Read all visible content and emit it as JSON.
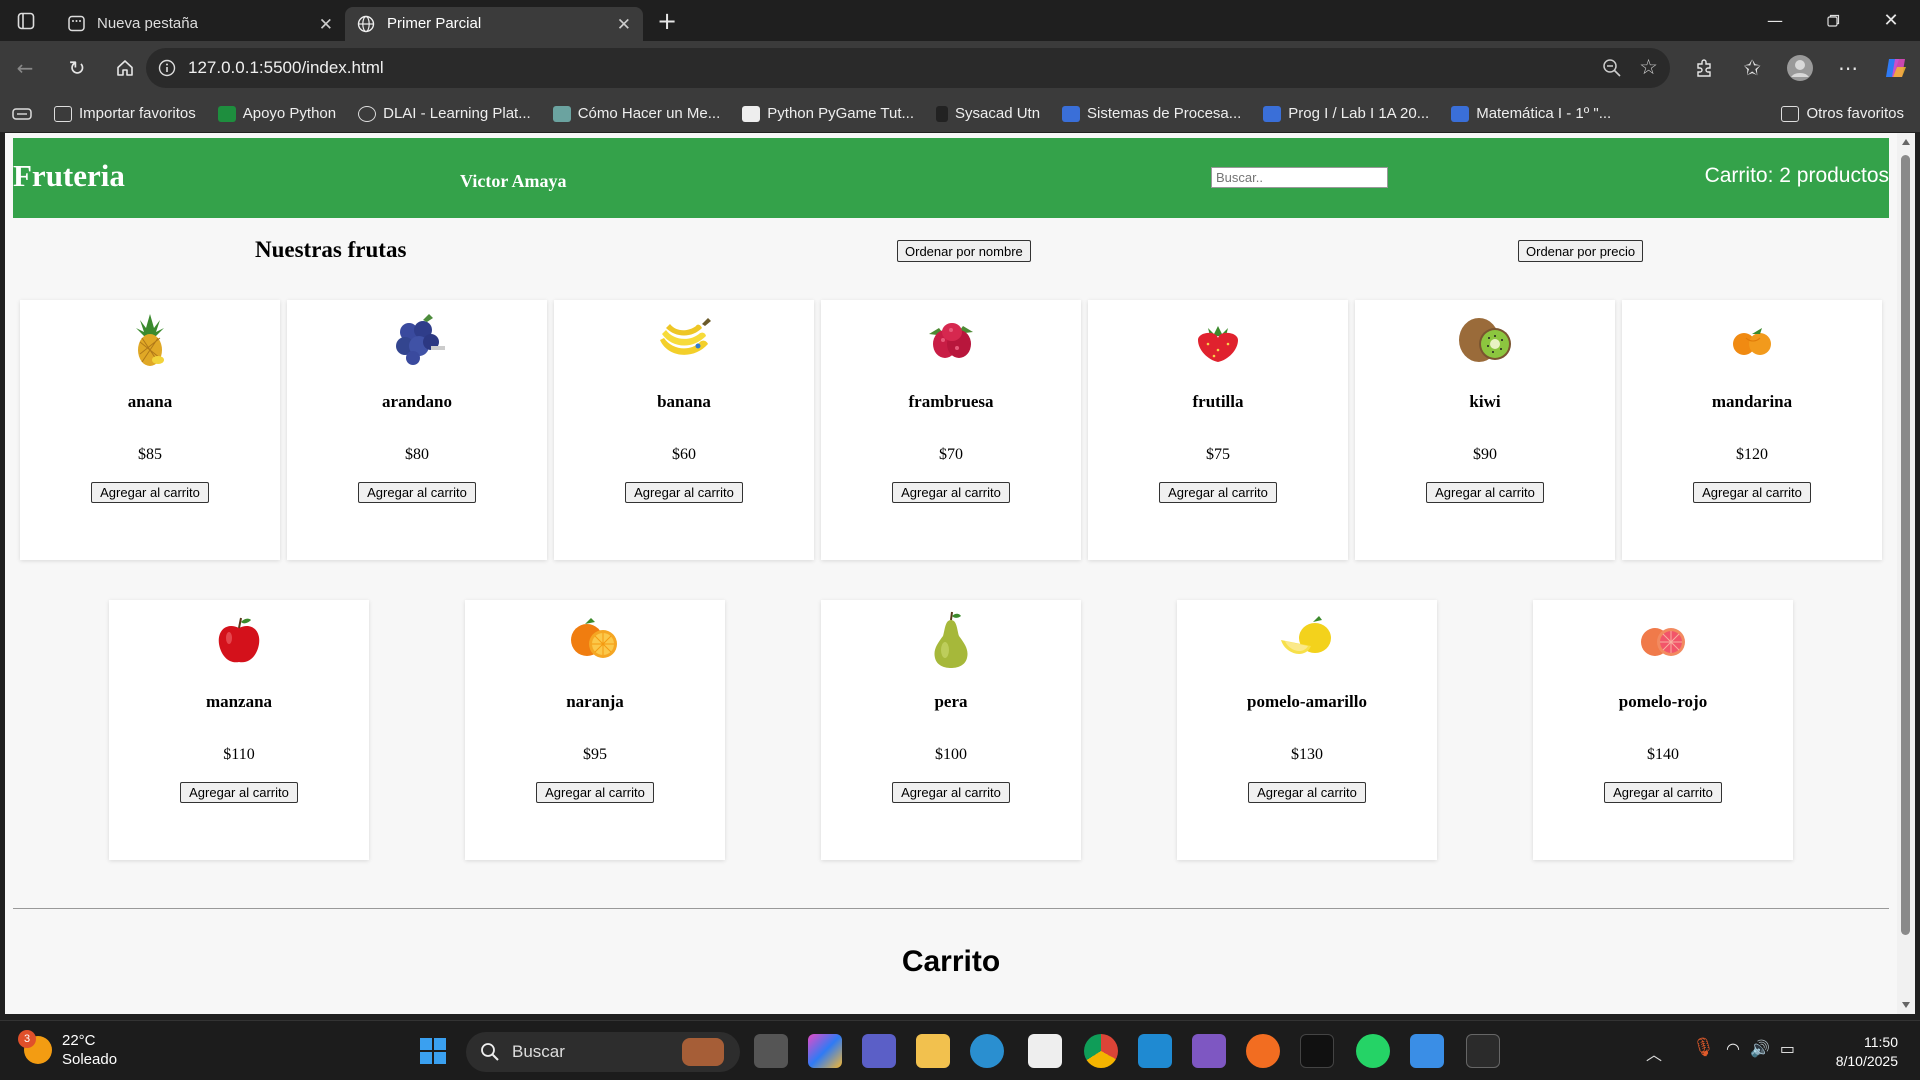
{
  "browser": {
    "tabs": [
      {
        "title": "Nueva pestaña",
        "active": false
      },
      {
        "title": "Primer Parcial",
        "active": true
      }
    ],
    "url": "127.0.0.1:5500/index.html",
    "bookmarks": [
      "Importar favoritos",
      "Apoyo Python",
      "DLAI - Learning Plat...",
      "Cómo Hacer un Me...",
      "Python PyGame Tut...",
      "Sysacad Utn",
      "Sistemas de Procesa...",
      "Prog I / Lab I 1A 20...",
      "Matemática I - 1º \"..."
    ],
    "other_bookmarks": "Otros favoritos"
  },
  "site": {
    "brand": "Fruteria",
    "author": "Victor Amaya",
    "search_placeholder": "Buscar..",
    "cart_count": "Carrito: 2 productos",
    "section_title": "Nuestras frutas",
    "sort_by_name": "Ordenar por nombre",
    "sort_by_price": "Ordenar por precio",
    "add_label": "Agregar al carrito",
    "cart_title": "Carrito",
    "accent_color": "#34a24a",
    "products": [
      {
        "name": "anana",
        "price": "$85",
        "icon": "pineapple-icon"
      },
      {
        "name": "arandano",
        "price": "$80",
        "icon": "blueberry-icon"
      },
      {
        "name": "banana",
        "price": "$60",
        "icon": "banana-icon"
      },
      {
        "name": "frambruesa",
        "price": "$70",
        "icon": "raspberry-icon"
      },
      {
        "name": "frutilla",
        "price": "$75",
        "icon": "strawberry-icon"
      },
      {
        "name": "kiwi",
        "price": "$90",
        "icon": "kiwi-icon"
      },
      {
        "name": "mandarina",
        "price": "$120",
        "icon": "tangerine-icon"
      },
      {
        "name": "manzana",
        "price": "$110",
        "icon": "apple-icon"
      },
      {
        "name": "naranja",
        "price": "$95",
        "icon": "orange-icon"
      },
      {
        "name": "pera",
        "price": "$100",
        "icon": "pear-icon"
      },
      {
        "name": "pomelo-amarillo",
        "price": "$130",
        "icon": "yellow-grapefruit-icon"
      },
      {
        "name": "pomelo-rojo",
        "price": "$140",
        "icon": "red-grapefruit-icon"
      }
    ]
  },
  "taskbar": {
    "temperature": "22°C",
    "weather": "Soleado",
    "weather_badge": "3",
    "search": "Buscar",
    "time": "11:50",
    "date": "8/10/2025"
  }
}
